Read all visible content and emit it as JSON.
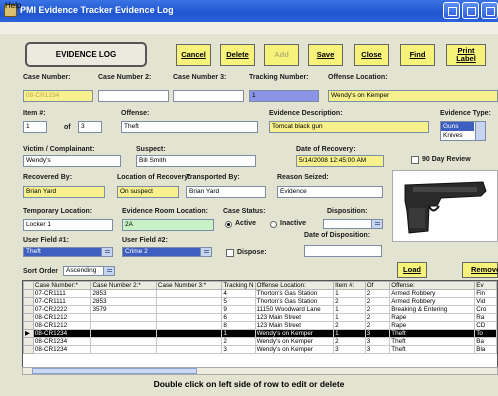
{
  "window": {
    "title": "PMI Evidence Tracker Evidence Log"
  },
  "menu": {
    "help": "Help"
  },
  "toolbar": {
    "logo": "EVIDENCE LOG",
    "buttons": {
      "cancel": "Cancel",
      "delete": "Delete",
      "add": "Add",
      "save": "Save",
      "close": "Close",
      "find": "Find",
      "print_label": "Print Label"
    }
  },
  "form": {
    "case_number_label": "Case Number:",
    "case_number": "08-CR1234",
    "case_number2_label": "Case Number 2:",
    "case_number2": "",
    "case_number3_label": "Case Number 3:",
    "case_number3": "",
    "tracking_label": "Tracking Number:",
    "tracking": "1",
    "offense_location_label": "Offense Location:",
    "offense_location": "Wendy's on Kemper",
    "item_label": "Item #:",
    "item": "1",
    "of_label": "of",
    "of": "3",
    "offense_label": "Offense:",
    "offense": "Theft",
    "evidence_desc_label": "Evidence Description:",
    "evidence_desc": "Tomcat black gun",
    "evidence_type_label": "Evidence Type:",
    "evidence_types": [
      "Guns",
      "Knives"
    ],
    "victim_label": "Victim / Complainant:",
    "victim": "Wendy's",
    "suspect_label": "Suspect:",
    "suspect": "Bill Smith",
    "recovery_date_label": "Date of Recovery:",
    "recovery_date": "5/14/2008 12:45:00 AM",
    "ninety_day_label": "90 Day Review",
    "recovered_by_label": "Recovered By:",
    "recovered_by": "Brian Yard",
    "location_recovery_label": "Location of Recovery:",
    "location_recovery": "On suspect",
    "transported_by_label": "Transported By:",
    "transported_by": "Brian Yard",
    "reason_seized_label": "Reason Seized:",
    "reason_seized": "Evidence",
    "temp_location_label": "Temporary Location:",
    "temp_location": "Locker 1",
    "evidence_room_label": "Evidence Room Location:",
    "evidence_room": "2A",
    "case_status_label": "Case Status:",
    "active_label": "Active",
    "inactive_label": "Inactive",
    "disposition_label": "Disposition:",
    "user_field1_label": "User Field #1:",
    "user_field1": "Theft",
    "user_field2_label": "User Field #2:",
    "user_field2": "Crime 2",
    "dispose_label": "Dispose:",
    "date_disposition_label": "Date of Disposition:",
    "sort_order_label": "Sort Order",
    "sort_order": "Ascending",
    "load_label": "Load",
    "remove_label": "Remove"
  },
  "grid": {
    "headers": [
      "Case Number:*",
      "Case Number 2:*",
      "Case Number 3:*",
      "Tracking N",
      "Offense Location:",
      "Item #:",
      "Of",
      "Offense:",
      "Ev"
    ],
    "rows": [
      [
        "07-CR1111",
        "2853",
        "",
        "4",
        "Thorton's Gas Station",
        "1",
        "2",
        "Armed Robbery",
        "Fin"
      ],
      [
        "07-CR1111",
        "2853",
        "",
        "5",
        "Thorton's Gas Station",
        "2",
        "2",
        "Armed Robbery",
        "Vid"
      ],
      [
        "07-CR2222",
        "3579",
        "",
        "9",
        "11150 Woodward Lane",
        "1",
        "2",
        "Breaking & Entering",
        "Cro"
      ],
      [
        "08-CR1212",
        "",
        "",
        "6",
        "123 Main Street",
        "1",
        "2",
        "Rape",
        "Ra"
      ],
      [
        "08-CR1212",
        "",
        "",
        "8",
        "123 Main Street",
        "2",
        "2",
        "Rape",
        "CD"
      ],
      [
        "08-CR1234",
        "",
        "",
        "1",
        "Wendy's on Kemper",
        "1",
        "3",
        "Theft",
        "To"
      ],
      [
        "08-CR1234",
        "",
        "",
        "2",
        "Wendy's on Kemper",
        "2",
        "3",
        "Theft",
        "Ba"
      ],
      [
        "08-CR1234",
        "",
        "",
        "3",
        "Wendy's on Kemper",
        "3",
        "3",
        "Theft",
        "Bla"
      ]
    ]
  },
  "footer": "Double click on left side of row to edit or delete"
}
